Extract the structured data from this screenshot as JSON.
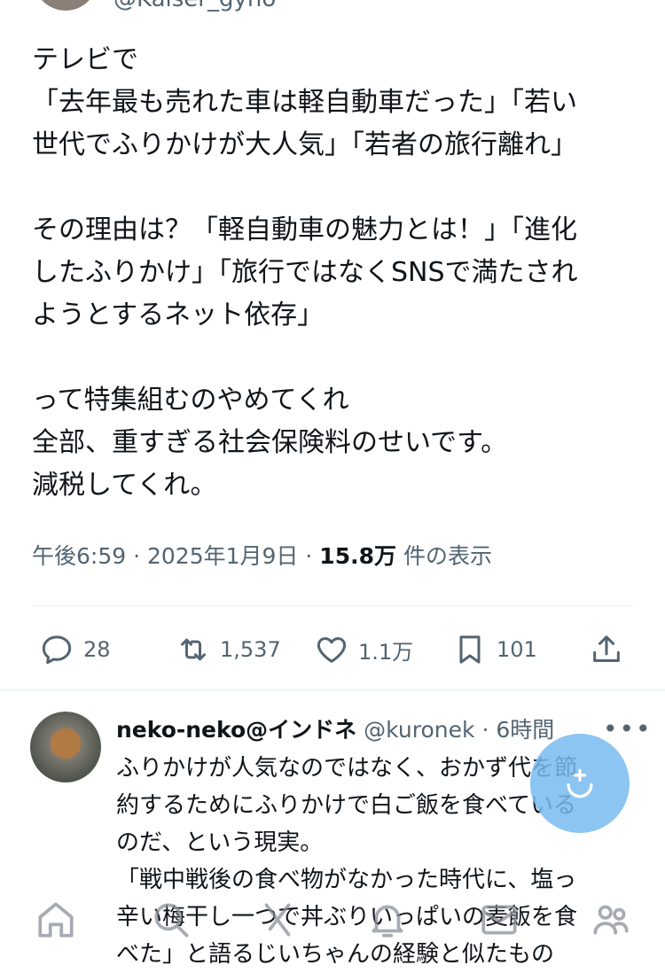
{
  "header": {
    "handle": "@Kaiser_gyno"
  },
  "tweet": {
    "lines": [
      "テレビで",
      "「去年最も売れた車は軽自動車だった」「若い",
      "世代でふりかけが大人気」「若者の旅行離れ」",
      "",
      "その理由は？「軽自動車の魅力とは！」「進化",
      "したふりかけ」「旅行ではなくSNSで満たされ",
      "ようとするネット依存」",
      "",
      "って特集組むのやめてくれ",
      "全部、重すぎる社会保険料のせいです。",
      "減税してくれ。"
    ],
    "time": "午後6:59",
    "dot1": "·",
    "date": "2025年1月9日",
    "dot2": "·",
    "views": "15.8万",
    "views_label": "件の表示"
  },
  "actions": {
    "reply_count": "28",
    "retweet_count": "1,537",
    "like_count": "1.1万",
    "bookmark_count": "101"
  },
  "reply": {
    "name": "neko-neko@インドネ",
    "handle": "@kuronek",
    "time": "· 6時間",
    "more": "•••",
    "lines": [
      "ふりかけが人気なのではなく、おかず代を節",
      "約するためにふりかけで白ご飯を食べている",
      "のだ、という現実。",
      "「戦中戦後の食べ物がなかった時代に、塩っ",
      "辛い梅干し一つで丼ぶりいっぱいの麦飯を食",
      "べた」と語るじいちゃんの経験と似たもの"
    ]
  },
  "icons": {
    "reply": "reply-icon",
    "retweet": "retweet-icon",
    "like": "heart-icon",
    "bookmark": "bookmark-icon",
    "share": "share-icon",
    "compose": "compose-icon",
    "home": "home-icon",
    "search": "search-icon",
    "grok": "grok-icon",
    "notifications": "bell-icon",
    "messages": "mail-icon",
    "communities": "people-icon"
  },
  "colors": {
    "text": "#0f1419",
    "secondary": "#536471",
    "accent": "#1d9bf0"
  }
}
